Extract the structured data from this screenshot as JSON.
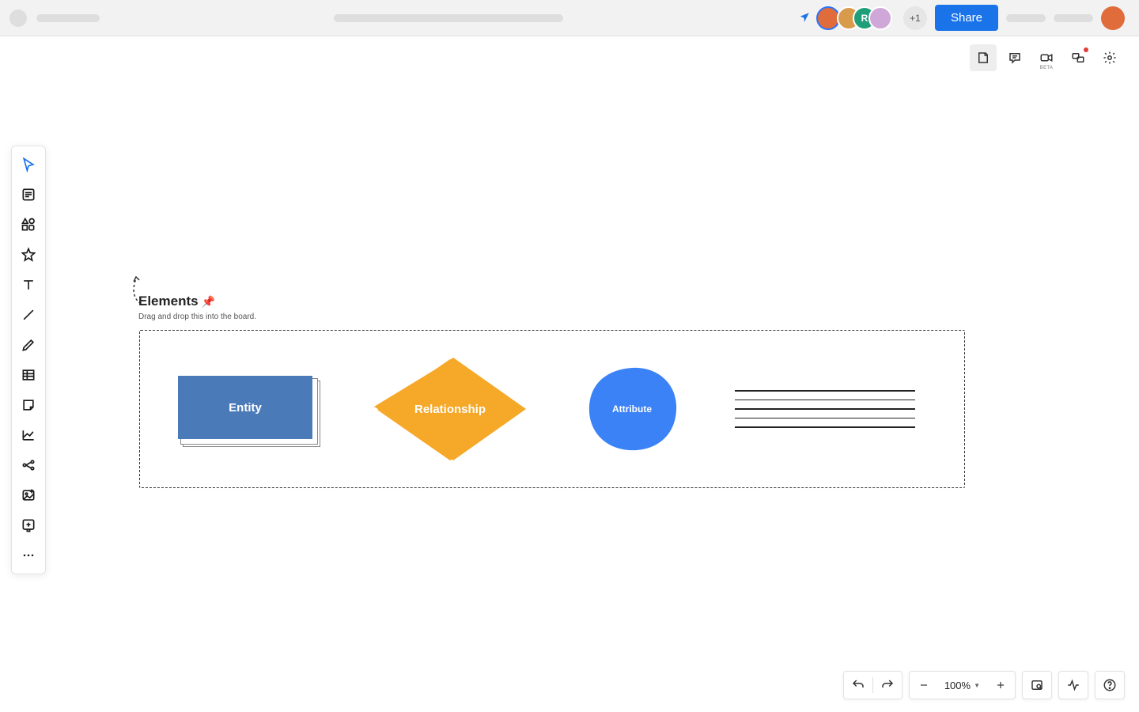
{
  "header": {
    "share_label": "Share",
    "extra_count": "+1",
    "avatar_letter": "R"
  },
  "subheader": {
    "beta_label": "BETA"
  },
  "canvas": {
    "elements_title": "Elements",
    "elements_sub": "Drag and drop this into the board.",
    "entity_label": "Entity",
    "relationship_label": "Relationship",
    "attribute_label": "Attribute"
  },
  "footer": {
    "zoom": "100%"
  },
  "colors": {
    "accent": "#1a73e8",
    "entity": "#4a7ab8",
    "relationship": "#f5a623",
    "attribute": "#3b82f6"
  }
}
